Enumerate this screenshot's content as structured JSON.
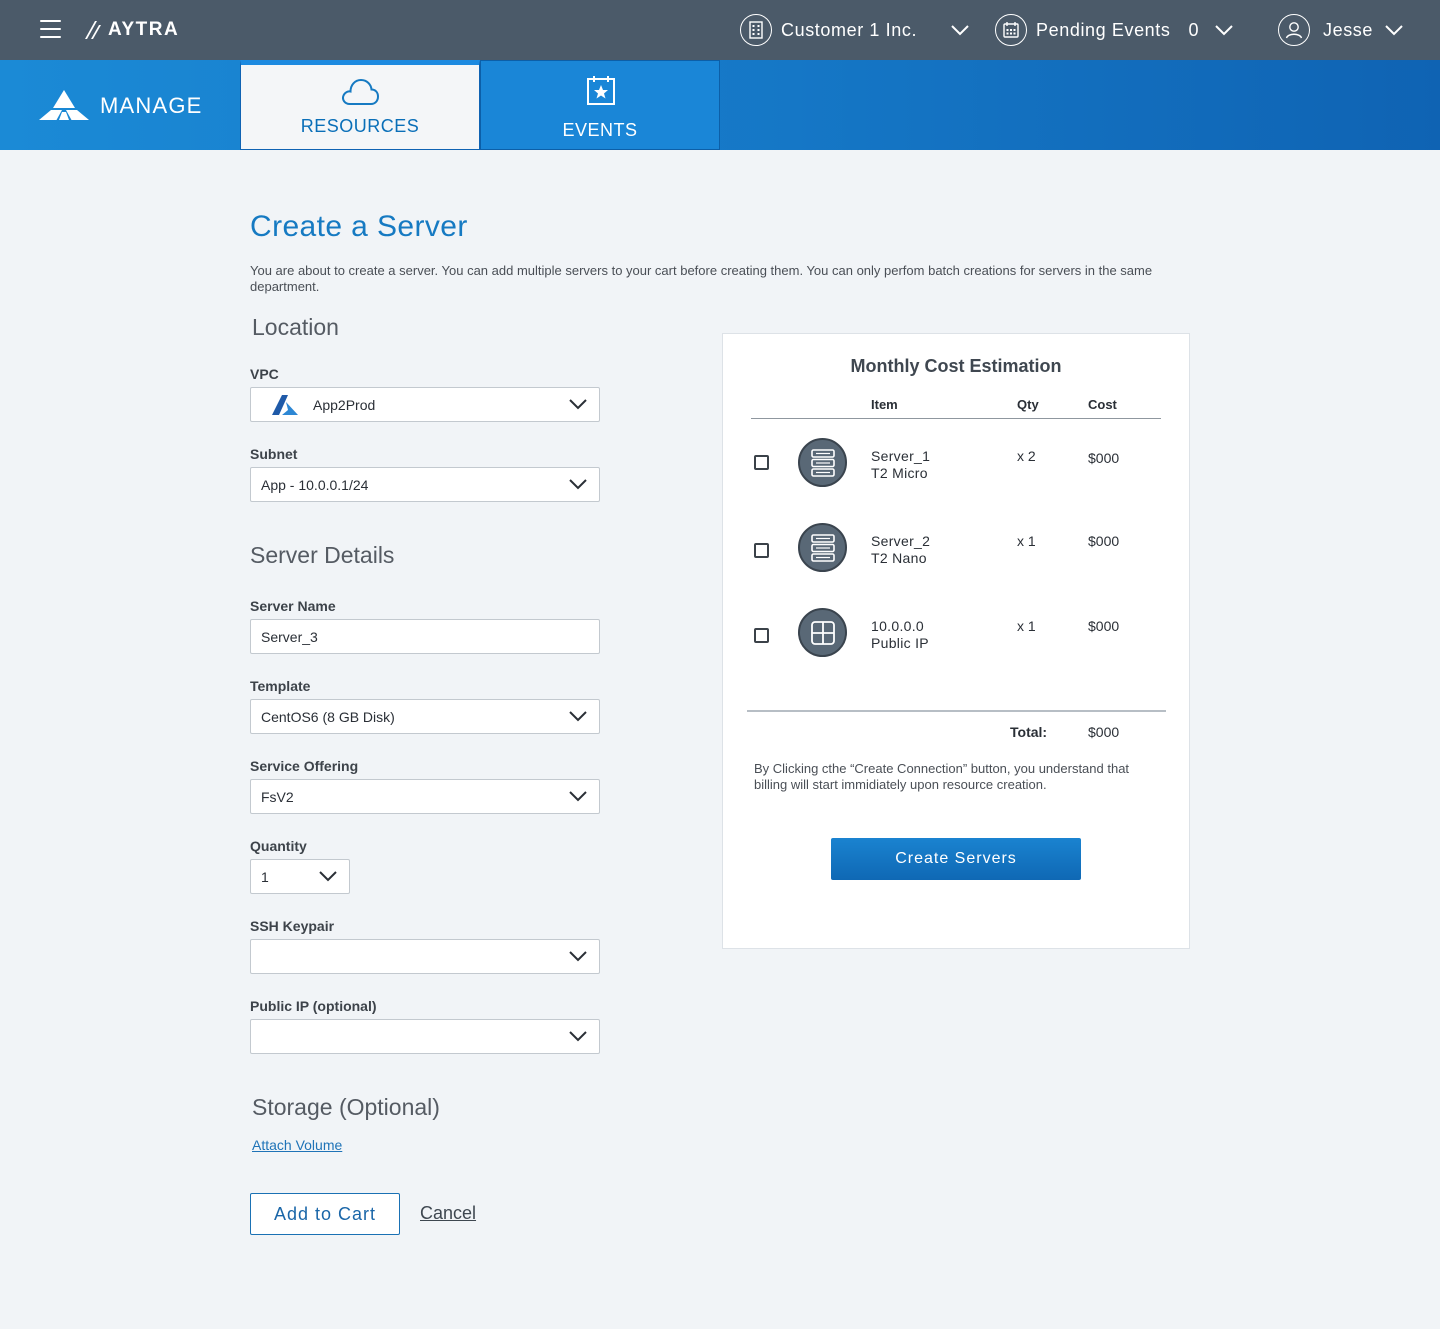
{
  "topbar": {
    "brand": "AYTRA",
    "customer": "Customer 1 Inc.",
    "pending_label": "Pending Events",
    "pending_count": "0",
    "user": "Jesse"
  },
  "nav": {
    "app": "MANAGE",
    "tabs": [
      {
        "label": "RESOURCES",
        "active": true
      },
      {
        "label": "EVENTS",
        "active": false
      }
    ]
  },
  "page": {
    "title": "Create a Server",
    "description": "You are about to create a server. You can add multiple servers to your cart before creating them. You can only perfom batch creations for servers in the same department."
  },
  "location": {
    "heading": "Location",
    "vpc_label": "VPC",
    "vpc_value": "App2Prod",
    "subnet_label": "Subnet",
    "subnet_value": "App - 10.0.0.1/24"
  },
  "details": {
    "heading": "Server Details",
    "name_label": "Server Name",
    "name_value": "Server_3",
    "template_label": "Template",
    "template_value": "CentOS6 (8 GB Disk)",
    "offering_label": "Service Offering",
    "offering_value": "FsV2",
    "quantity_label": "Quantity",
    "quantity_value": "1",
    "ssh_label": "SSH Keypair",
    "ssh_value": "",
    "publicip_label": "Public IP (optional)",
    "publicip_value": ""
  },
  "storage": {
    "heading": "Storage (Optional)",
    "attach_link": "Attach Volume"
  },
  "actions": {
    "add_to_cart": "Add to Cart",
    "cancel": "Cancel"
  },
  "cost_panel": {
    "title": "Monthly Cost Estimation",
    "headers": {
      "item": "Item",
      "qty": "Qty",
      "cost": "Cost"
    },
    "items": [
      {
        "name": "Server_1",
        "sub": "T2 Micro",
        "qty": "x 2",
        "cost": "$000",
        "icon": "server-icon",
        "checked": false
      },
      {
        "name": "Server_2",
        "sub": "T2 Nano",
        "qty": "x 1",
        "cost": "$000",
        "icon": "server-icon",
        "checked": false
      },
      {
        "name": "10.0.0.0",
        "sub": "Public IP",
        "qty": "x 1",
        "cost": "$000",
        "icon": "ip-grid-icon",
        "checked": false
      }
    ],
    "total_label": "Total:",
    "total_value": "$000",
    "note": "By Clicking cthe “Create Connection” button, you understand that billing will start immidiately upon resource creation.",
    "create_button": "Create Servers"
  },
  "colors": {
    "topbar": "#4b5a69",
    "nav_blue": "#1577c6",
    "accent": "#167ac2",
    "background": "#f1f4f7"
  }
}
